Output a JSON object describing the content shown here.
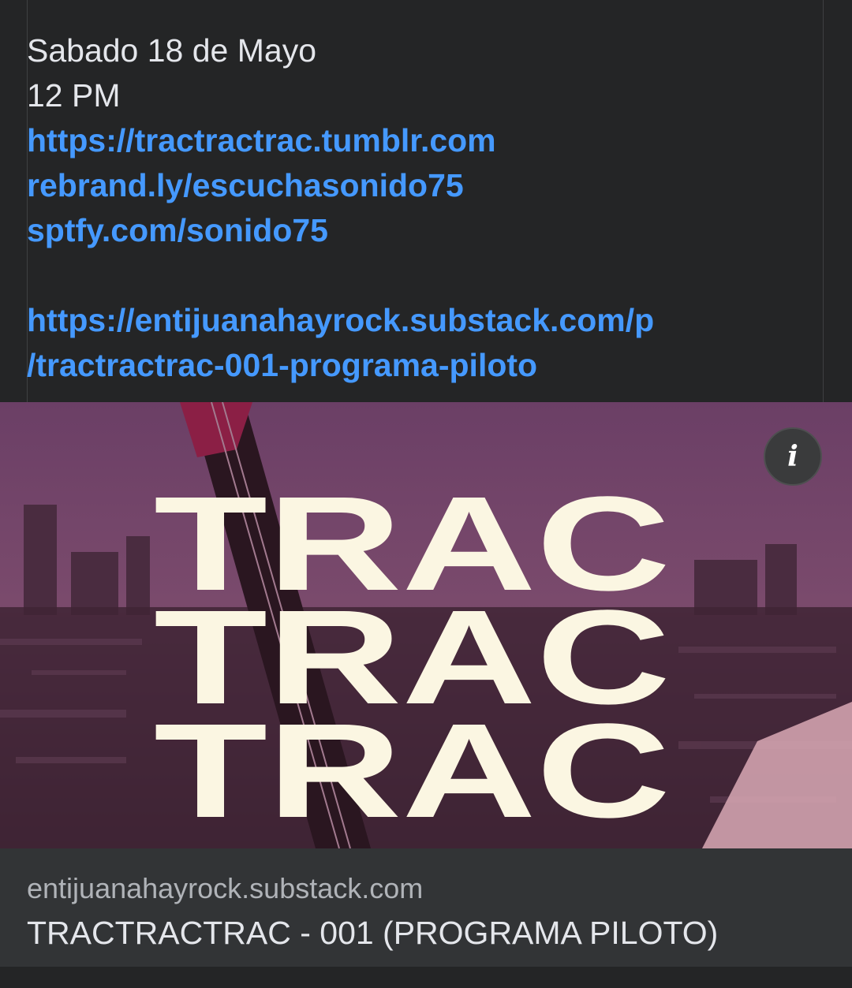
{
  "post": {
    "lines": {
      "date": "Sabado 18 de Mayo",
      "time": "12 PM",
      "link1": "https://tractractrac.tumblr.com",
      "link2": "rebrand.ly/escuchasonido75",
      "link3": "sptfy.com/sonido75",
      "link4a": "https://entijuanahayrock.substack.com/p",
      "link4b": "/tractractrac-001-programa-piloto"
    }
  },
  "preview": {
    "logo_text": "TRAC",
    "info_icon": "info-icon",
    "info_label": "i"
  },
  "link_card": {
    "domain": "entijuanahayrock.substack.com",
    "title": "TRACTRACTRAC - 001 (PROGRAMA PILOTO)"
  },
  "colors": {
    "background": "#242526",
    "link": "#4599ff",
    "text": "#e4e6eb",
    "subtext": "#b0b3b8",
    "logo_fill": "#fbf6e2",
    "image_tint": "#5a3550"
  }
}
